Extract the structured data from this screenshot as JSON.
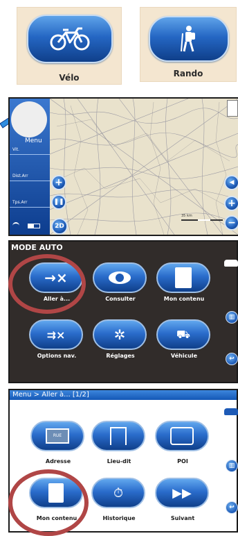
{
  "modes": {
    "bike_label": "Vélo",
    "hike_label": "Rando"
  },
  "map_screen": {
    "menu_label": "Menu",
    "fields": [
      "Vit.",
      "Dist.Arr",
      "Tps.Arr"
    ],
    "view_label": "2D",
    "scale_label": "35 km"
  },
  "auto_menu": {
    "title": "MODE AUTO",
    "buttons": [
      "Aller à...",
      "Consulter",
      "Mon contenu",
      "Options nav.",
      "Réglages",
      "Véhicule"
    ]
  },
  "goto_menu": {
    "breadcrumb": "Menu > Aller à... [1/2]",
    "buttons": [
      "Adresse",
      "Lieu-dit",
      "POI",
      "Mon contenu",
      "Historique",
      "Suivant"
    ],
    "street_sign": "RUE"
  },
  "colors": {
    "button_blue": "#2a6ccb",
    "highlight_red": "#b04646",
    "menu_dark": "#312c2a"
  }
}
